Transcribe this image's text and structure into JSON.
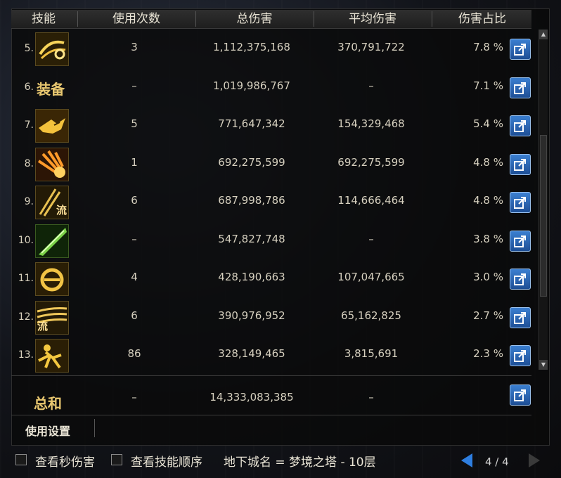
{
  "headers": {
    "skill": "技能",
    "uses": "使用次数",
    "total": "总伤害",
    "avg": "平均伤害",
    "pct": "伤害占比"
  },
  "rows": [
    {
      "num": "5.",
      "icon": "spiral-slash-skill-icon",
      "uses": "3",
      "total": "1,112,375,168",
      "avg": "370,791,722",
      "pct": "7.8 %"
    },
    {
      "num": "6.",
      "icon": "equipment-label",
      "icon_text": "装备",
      "uses": "–",
      "total": "1,019,986,767",
      "avg": "–",
      "pct": "7.1 %"
    },
    {
      "num": "7.",
      "icon": "beast-claw-skill-icon",
      "uses": "5",
      "total": "771,647,342",
      "avg": "154,329,468",
      "pct": "5.4 %"
    },
    {
      "num": "8.",
      "icon": "flame-burst-skill-icon",
      "uses": "1",
      "total": "692,275,599",
      "avg": "692,275,599",
      "pct": "4.8 %"
    },
    {
      "num": "9.",
      "icon": "flow-slash-skill-icon",
      "icon_text": "流",
      "uses": "6",
      "total": "687,998,786",
      "avg": "114,666,464",
      "pct": "4.8 %"
    },
    {
      "num": "10.",
      "icon": "green-blade-skill-icon",
      "uses": "–",
      "total": "547,827,748",
      "avg": "–",
      "pct": "3.8 %"
    },
    {
      "num": "11.",
      "icon": "e-ring-skill-icon",
      "uses": "4",
      "total": "428,190,663",
      "avg": "107,047,665",
      "pct": "3.0 %"
    },
    {
      "num": "12.",
      "icon": "flow-wave-skill-icon",
      "icon_text": "流",
      "uses": "6",
      "total": "390,976,952",
      "avg": "65,162,825",
      "pct": "2.7 %"
    },
    {
      "num": "13.",
      "icon": "dash-strike-skill-icon",
      "uses": "86",
      "total": "328,149,465",
      "avg": "3,815,691",
      "pct": "2.3 %"
    }
  ],
  "total": {
    "label": "总和",
    "uses": "–",
    "total": "14,333,083,385",
    "avg": "–"
  },
  "settings_label": "使用设置",
  "footer": {
    "opt1": "查看秒伤害",
    "opt2": "查看技能顺序",
    "dungeon": "地下城名 = 梦境之塔 - 10层",
    "page": "4 / 4"
  },
  "colors": {
    "accent": "#e8c770",
    "share_button": "#2d68b8",
    "text": "#d6d0bf"
  }
}
